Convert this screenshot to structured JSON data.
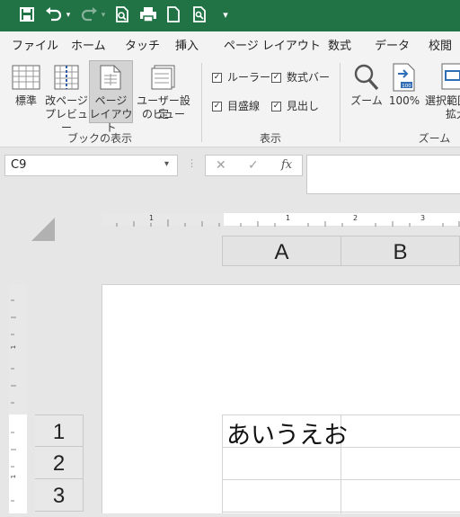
{
  "qat": {
    "save_icon": "save-icon",
    "undo_icon": "undo-icon",
    "redo_icon": "redo-icon",
    "print_preview_icon": "print-preview-icon",
    "print_icon": "print-icon",
    "new_icon": "new-document-icon",
    "find_icon": "find-icon",
    "customize_icon": "customize-qat-icon"
  },
  "menu": [
    "ファイル",
    "ホーム",
    "タッチ",
    "挿入",
    "ページ レイアウト",
    "数式",
    "データ",
    "校閲"
  ],
  "ribbon": {
    "workbook_views": {
      "buttons": [
        {
          "line1": "標準",
          "line2": ""
        },
        {
          "line1": "改ページ",
          "line2": "プレビュー"
        },
        {
          "line1": "ページ",
          "line2": "レイアウト"
        },
        {
          "line1": "ユーザー設定",
          "line2": "のビュー"
        }
      ],
      "label": "ブックの表示",
      "active_index": 2
    },
    "show": {
      "items": [
        {
          "label": "ルーラー",
          "checked": true
        },
        {
          "label": "数式バー",
          "checked": true
        },
        {
          "label": "目盛線",
          "checked": true
        },
        {
          "label": "見出し",
          "checked": true
        }
      ],
      "label": "表示"
    },
    "zoom": {
      "zoom_label": "ズーム",
      "percent_label": "100%",
      "selection_line1": "選択範囲",
      "selection_line2": "拡大",
      "label": "ズーム"
    }
  },
  "formula_bar": {
    "name_box": "C9",
    "cancel_glyph": "✕",
    "enter_glyph": "✓",
    "fx_label": "fx",
    "content": ""
  },
  "rulers": {
    "top_labels": [
      "1",
      "1",
      "2",
      "3"
    ],
    "left_label": "1"
  },
  "sheet": {
    "columns": [
      "A",
      "B"
    ],
    "rows": [
      "1",
      "2",
      "3"
    ],
    "cells": {
      "A1": "あいうえお"
    }
  }
}
